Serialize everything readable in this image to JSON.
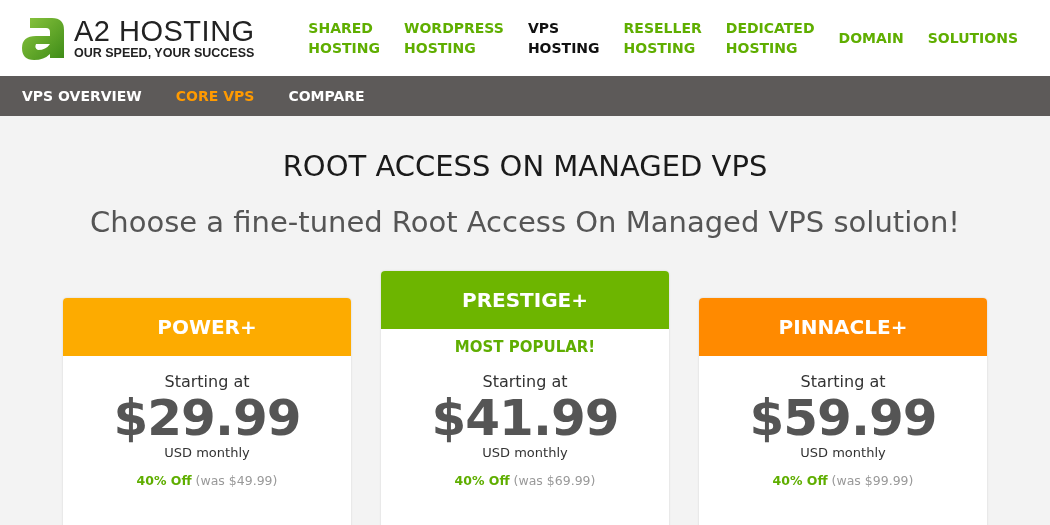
{
  "logo": {
    "name": "A2 HOSTING",
    "tagline": "OUR SPEED, YOUR SUCCESS"
  },
  "main_nav": [
    {
      "label": "SHARED\nHOSTING",
      "selected": false
    },
    {
      "label": "WORDPRESS\nHOSTING",
      "selected": false
    },
    {
      "label": "VPS\nHOSTING",
      "selected": true
    },
    {
      "label": "RESELLER\nHOSTING",
      "selected": false
    },
    {
      "label": "DEDICATED\nHOSTING",
      "selected": false
    },
    {
      "label": "DOMAIN",
      "selected": false
    },
    {
      "label": "SOLUTIONS",
      "selected": false
    }
  ],
  "sub_nav": [
    {
      "label": "VPS OVERVIEW",
      "selected": false
    },
    {
      "label": "CORE VPS",
      "selected": true
    },
    {
      "label": "COMPARE",
      "selected": false
    }
  ],
  "heading": "ROOT ACCESS ON MANAGED VPS",
  "subheading": "Choose a fine-tuned Root Access On Managed VPS solution!",
  "plans": [
    {
      "name": "POWER+",
      "color": "#fdab00",
      "starting": "Starting at",
      "price": "$29.99",
      "period": "USD monthly",
      "discount": "40% Off",
      "was": "(was $49.99)"
    },
    {
      "name": "PRESTIGE+",
      "color": "#6db500",
      "badge": "MOST POPULAR!",
      "starting": "Starting at",
      "price": "$41.99",
      "period": "USD monthly",
      "discount": "40% Off",
      "was": "(was $69.99)"
    },
    {
      "name": "PINNACLE+",
      "color": "#ff8a00",
      "starting": "Starting at",
      "price": "$59.99",
      "period": "USD monthly",
      "discount": "40% Off",
      "was": "(was $99.99)"
    }
  ]
}
